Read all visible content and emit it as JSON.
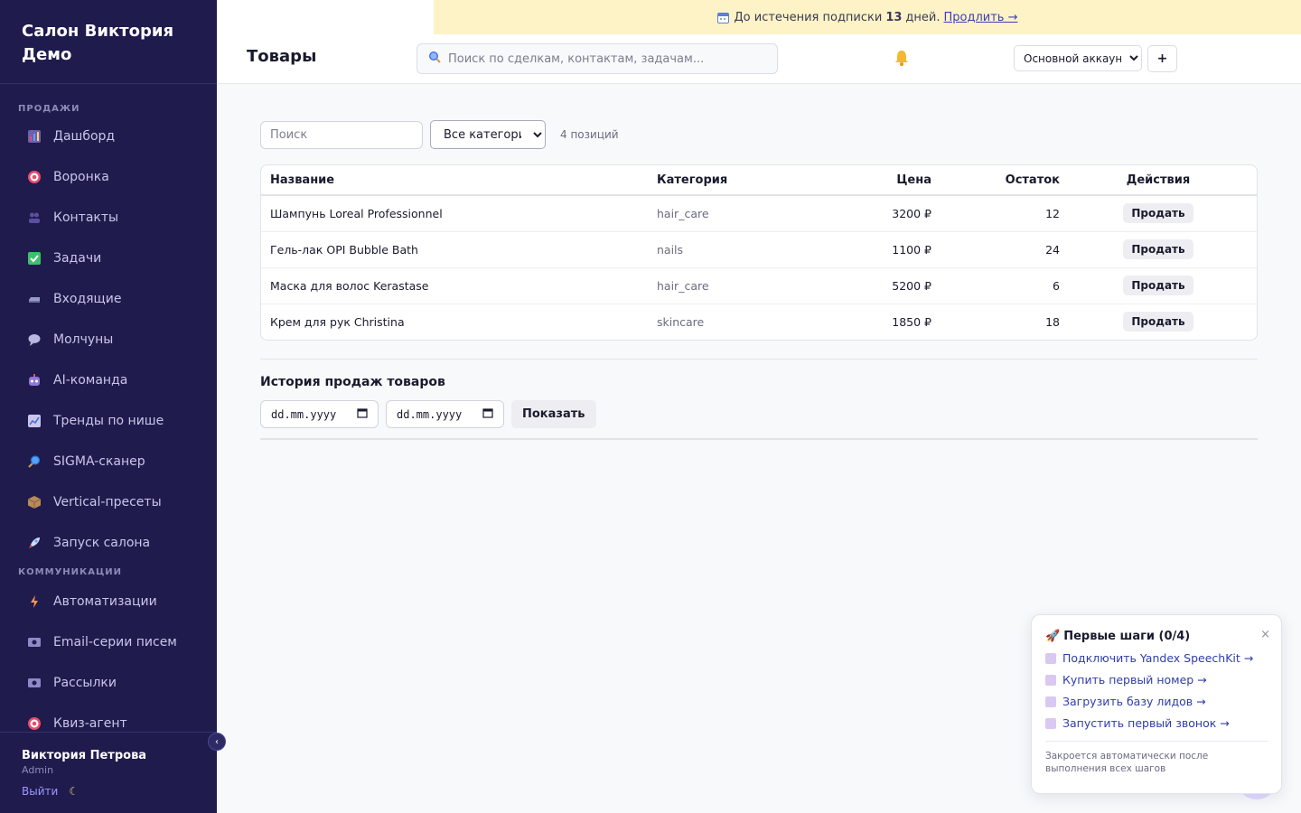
{
  "sidebar": {
    "brand": "Салон Виктория Демо",
    "sections": [
      {
        "label": "ПРОДАЖИ",
        "items": [
          {
            "label": "Дашборд",
            "icon": "chart-icon"
          },
          {
            "label": "Воронка",
            "icon": "target-icon"
          },
          {
            "label": "Контакты",
            "icon": "users-icon"
          },
          {
            "label": "Задачи",
            "icon": "check-icon"
          },
          {
            "label": "Входящие",
            "icon": "inbox-icon"
          },
          {
            "label": "Молчуны",
            "icon": "speech-bubble-icon"
          },
          {
            "label": "AI-команда",
            "icon": "robot-icon"
          },
          {
            "label": "Тренды по нише",
            "icon": "trend-icon"
          },
          {
            "label": "SIGMA-сканер",
            "icon": "magnifier-icon"
          },
          {
            "label": "Vertical-пресеты",
            "icon": "package-icon"
          },
          {
            "label": "Запуск салона",
            "icon": "rocket-icon"
          }
        ]
      },
      {
        "label": "КОММУНИКАЦИИ",
        "items": [
          {
            "label": "Автоматизации",
            "icon": "lightning-icon"
          },
          {
            "label": "Email-серии писем",
            "icon": "mail-icon"
          },
          {
            "label": "Рассылки",
            "icon": "mail-icon"
          },
          {
            "label": "Квиз-агент",
            "icon": "target-icon"
          }
        ]
      }
    ],
    "user": {
      "name": "Виктория Петрова",
      "role": "Admin",
      "logout": "Выйти"
    },
    "collapse_glyph": "‹"
  },
  "banner": {
    "icon": "calendar-icon",
    "prefix": "До истечения подписки",
    "days": "13",
    "suffix": "дней.",
    "link": "Продлить →"
  },
  "header": {
    "title": "Товары",
    "search_placeholder": "Поиск по сделкам, контактам, задачам...",
    "account": "Основной аккаунт",
    "plus": "+"
  },
  "filters": {
    "search_placeholder": "Поиск",
    "category": "Все категории",
    "count": "4 позиций"
  },
  "table": {
    "columns": [
      "Название",
      "Категория",
      "Цена",
      "Остаток",
      "Действия"
    ],
    "rows": [
      {
        "name": "Шампунь Loreal Professionnel",
        "category": "hair_care",
        "price": "3200 ₽",
        "stock": "12",
        "action": "Продать"
      },
      {
        "name": "Гель-лак OPI Bubble Bath",
        "category": "nails",
        "price": "1100 ₽",
        "stock": "24",
        "action": "Продать"
      },
      {
        "name": "Маска для волос Kerastase",
        "category": "hair_care",
        "price": "5200 ₽",
        "stock": "6",
        "action": "Продать"
      },
      {
        "name": "Крем для рук Christina",
        "category": "skincare",
        "price": "1850 ₽",
        "stock": "18",
        "action": "Продать"
      }
    ]
  },
  "history": {
    "title": "История продаж товаров",
    "date_from": "dd.mm.yyyy",
    "date_to": "dd.mm.yyyy",
    "show": "Показать"
  },
  "onboarding": {
    "title": "Первые шаги (0/4)",
    "close": "×",
    "steps": [
      "Подключить Yandex SpeechKit →",
      "Купить первый номер →",
      "Загрузить базу лидов →",
      "Запустить первый звонок →"
    ],
    "note": "Закроется автоматически после выполнения всех шагов"
  }
}
